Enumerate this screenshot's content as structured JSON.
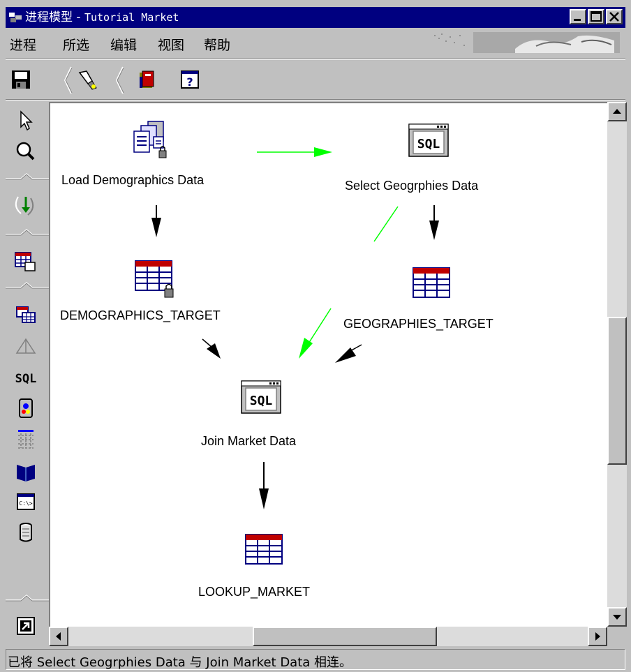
{
  "window": {
    "title_prefix": "进程模型 - ",
    "title_name": "Tutorial Market"
  },
  "menu": {
    "items": [
      "进程",
      "所选",
      "编辑",
      "视图",
      "帮助"
    ]
  },
  "toolbar": {
    "icons": [
      "save-icon",
      "flashlight-icon",
      "book-icon",
      "help-icon"
    ]
  },
  "palette": {
    "icons": [
      "pointer-icon",
      "zoom-icon",
      "link-arrow-icon",
      "table-step-icon",
      "multi-table-icon",
      "triangle-icon",
      "sql-icon",
      "program-icon",
      "grid-icon",
      "book-blue-icon",
      "command-icon",
      "cylinder-icon",
      "shortcut-icon"
    ],
    "sql_label": "SQL"
  },
  "nodes": {
    "load_demographics": "Load Demographics Data",
    "select_geographies": "Select Geogrphies Data",
    "demographics_target": "DEMOGRAPHICS_TARGET",
    "geographies_target": "GEOGRAPHIES_TARGET",
    "join_market": "Join Market Data",
    "lookup_market": "LOOKUP_MARKET"
  },
  "status": {
    "text": "已将 Select Geogrphies Data 与 Join Market Data 相连。"
  },
  "colors": {
    "titlebar": "#000080",
    "chrome": "#c0c0c0",
    "canvas": "#ffffff",
    "flow_black": "#000000",
    "flow_green": "#00ff00"
  }
}
